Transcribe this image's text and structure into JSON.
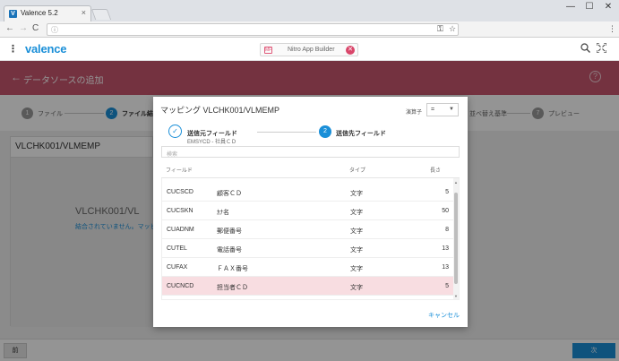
{
  "browser": {
    "tab_title": "Valence 5.2",
    "tab_favicon": "V",
    "close_glyph": "×",
    "window_controls": [
      "—",
      "☐",
      "✕"
    ],
    "nav": [
      "←",
      "→",
      "C"
    ],
    "address_info": "ⓘ",
    "key_icon": "⚿",
    "star_icon": "☆",
    "menu_icon": "⋮"
  },
  "app": {
    "menu_icon": "⋮",
    "logo": "valence",
    "chip_label": "Nitro App Builder",
    "chip_icon": "MF",
    "chip_close": "✕",
    "search_icon": "🔍",
    "expand_icon": "⛶"
  },
  "banner": {
    "back": "←",
    "title": "データソースの追加",
    "help": "?"
  },
  "stepper": {
    "steps": [
      {
        "num": "1",
        "label": "ファイル"
      },
      {
        "num": "2",
        "label": "ファイル結合"
      },
      {
        "num": "",
        "label": "並べ替え基準"
      },
      {
        "num": "7",
        "label": "プレビュー"
      }
    ]
  },
  "card": {
    "title": "VLCHK001/VLMEMP",
    "big_text": "VLCHK001/VL",
    "sub_text": "結合されていません。マッピング"
  },
  "footer": {
    "prev": "前",
    "next": "次"
  },
  "modal": {
    "title": "マッピング VLCHK001/VLMEMP",
    "operator_label": "演算子",
    "operator_value": "=",
    "operator_caret": "▼",
    "step1_check": "✓",
    "step1_label": "送信元フィールド",
    "step1_sub": "EMSYCD - 社員ＣＤ",
    "step2_num": "2",
    "step2_label": "送信先フィールド",
    "search_placeholder": "検索",
    "columns": {
      "field": "フィールド",
      "type": "タイプ",
      "length": "長さ"
    },
    "rows": [
      {
        "name": "CUCSCD",
        "desc": "顧客ＣＤ",
        "type": "文字",
        "length": "5",
        "highlighted": false
      },
      {
        "name": "CUCSKN",
        "desc": "ｶﾅ名",
        "type": "文字",
        "length": "50",
        "highlighted": false
      },
      {
        "name": "CUADNM",
        "desc": "郵便番号",
        "type": "文字",
        "length": "8",
        "highlighted": false
      },
      {
        "name": "CUTEL",
        "desc": "電話番号",
        "type": "文字",
        "length": "13",
        "highlighted": false
      },
      {
        "name": "CUFAX",
        "desc": "ＦＡＸ番号",
        "type": "文字",
        "length": "13",
        "highlighted": false
      },
      {
        "name": "CUCNCD",
        "desc": "担当者ＣＤ",
        "type": "文字",
        "length": "5",
        "highlighted": true
      }
    ],
    "scroll_up": "▲",
    "scroll_down": "▼",
    "cancel": "キャンセル"
  }
}
